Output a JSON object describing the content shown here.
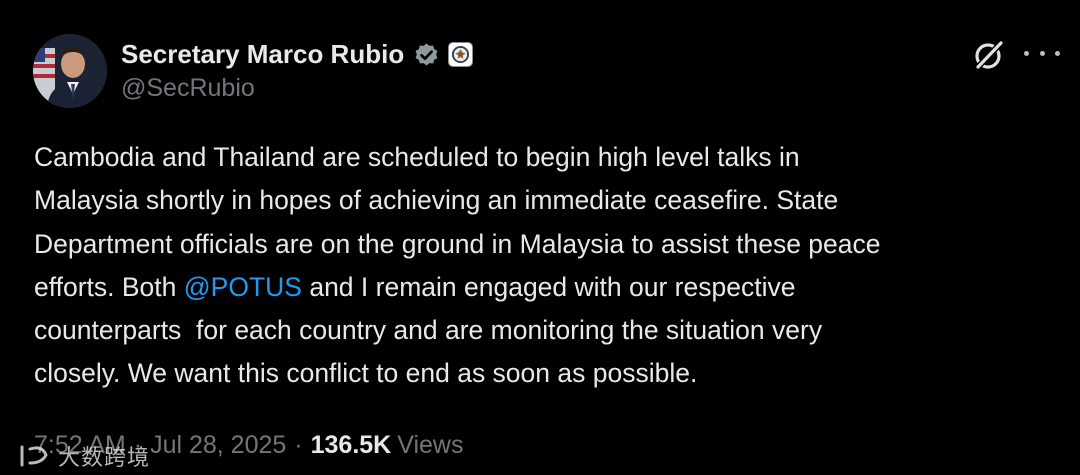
{
  "author": {
    "display_name": "Secretary Marco Rubio",
    "handle": "@SecRubio",
    "verified_icon": "verified-badge-icon",
    "affiliate_icon": "state-department-seal-icon",
    "verified_color": "#1d9bf0"
  },
  "actions": {
    "grok_icon": "grok-icon",
    "more_icon": "more-options-icon"
  },
  "tweet": {
    "lines": [
      "Cambodia and Thailand are scheduled to begin high level talks in",
      "Malaysia shortly in hopes of achieving an immediate ceasefire. State",
      "Department officials are on the ground in Malaysia to assist these peace",
      "efforts. Both ",
      "@POTUS",
      " and I remain engaged with our respective",
      "counterparts  for each country and are monitoring the situation very",
      "closely. We want this conflict to end as soon as possible."
    ],
    "mention_color": "#1d9bf0"
  },
  "meta": {
    "time": "7:52 AM",
    "date": "Jul 28, 2025",
    "separator": "·",
    "views_count": "136.5K",
    "views_label": "Views"
  },
  "watermark": {
    "text": "大数跨境"
  },
  "colors": {
    "background": "#000000",
    "primary_text": "#e7e9ea",
    "secondary_text": "#71767b",
    "link": "#1d9bf0"
  }
}
